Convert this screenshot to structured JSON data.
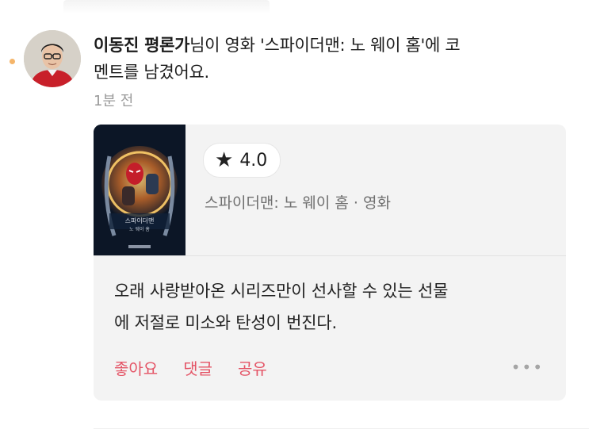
{
  "notification": {
    "user_name": "이동진 평론가",
    "message_part1": "님이 영화 '스파이더맨: 노 웨이 홈'에 코",
    "message_part2": "멘트를 남겼어요.",
    "time": "1분 전"
  },
  "card": {
    "rating": "4.0",
    "rating_icon": "star-icon",
    "movie_meta": "스파이더맨: 노 웨이 홈 · 영화",
    "poster_title": "스파이더맨",
    "poster_subtitle": "노 웨이 홈",
    "comment_line1": "오래 사랑받아온 시리즈만이 선사할 수 있는 선물",
    "comment_line2": "에 저절로 미소와 탄성이 번진다.",
    "actions": {
      "like": "좋아요",
      "comment": "댓글",
      "share": "공유"
    },
    "more": "•••"
  },
  "colors": {
    "accent": "#e45466",
    "card_bg": "#f3f3f3",
    "muted": "#9a9a9a",
    "unread_dot": "#f5b56a"
  }
}
